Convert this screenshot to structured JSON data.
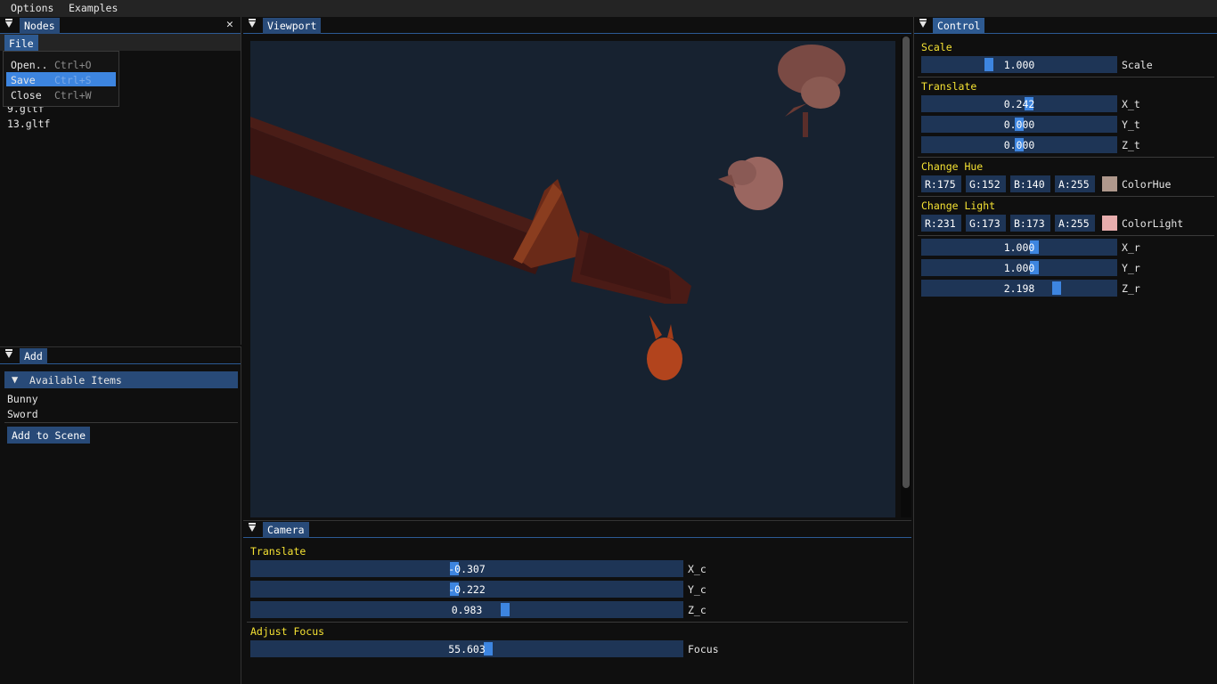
{
  "menubar": {
    "items": [
      "Options",
      "Examples"
    ]
  },
  "nodes_panel": {
    "tab": "Nodes",
    "close": "✕",
    "file_menu_label": "File",
    "file_menu": [
      {
        "label": "Open..",
        "shortcut": "Ctrl+O"
      },
      {
        "label": "Save",
        "shortcut": "Ctrl+S"
      },
      {
        "label": "Close",
        "shortcut": "Ctrl+W"
      }
    ],
    "files": [
      "9.gltf",
      "13.gltf"
    ]
  },
  "add_panel": {
    "tab": "Add",
    "header": "Available Items",
    "items": [
      "Bunny",
      "Sword"
    ],
    "button": "Add to Scene"
  },
  "viewport_panel": {
    "tab": "Viewport",
    "bg": "#172230"
  },
  "camera_panel": {
    "tab": "Camera",
    "translate_label": "Translate",
    "sliders": [
      {
        "label": "X_c",
        "value": "-0.307",
        "fraction": 0.47
      },
      {
        "label": "Y_c",
        "value": "-0.222",
        "fraction": 0.47
      },
      {
        "label": "Z_c",
        "value": "0.983",
        "fraction": 0.59
      }
    ],
    "focus_label": "Adjust Focus",
    "focus": {
      "label": "Focus",
      "value": "55.603",
      "fraction": 0.55
    }
  },
  "control_panel": {
    "tab": "Control",
    "scale_label": "Scale",
    "scale": {
      "label": "Scale",
      "value": "1.000",
      "fraction": 0.34
    },
    "translate_label": "Translate",
    "translate": [
      {
        "label": "X_t",
        "value": "0.242",
        "fraction": 0.55
      },
      {
        "label": "Y_t",
        "value": "0.000",
        "fraction": 0.5
      },
      {
        "label": "Z_t",
        "value": "0.000",
        "fraction": 0.5
      }
    ],
    "hue_label": "Change Hue",
    "hue": {
      "r": "R:175",
      "g": "G:152",
      "b": "B:140",
      "a": "A:255",
      "name": "ColorHue",
      "color": "#af988c"
    },
    "light_label": "Change Light",
    "light": {
      "r": "R:231",
      "g": "G:173",
      "b": "B:173",
      "a": "A:255",
      "name": "ColorLight",
      "color": "#e7adad"
    },
    "rotation": [
      {
        "label": "X_r",
        "value": "1.000",
        "fraction": 0.58
      },
      {
        "label": "Y_r",
        "value": "1.000",
        "fraction": 0.58
      },
      {
        "label": "Z_r",
        "value": "2.198",
        "fraction": 0.7
      }
    ]
  },
  "colors": {
    "accent": "#3d85e0",
    "frame": "#1e3556",
    "header": "#284a78",
    "label": "#f5e233"
  }
}
